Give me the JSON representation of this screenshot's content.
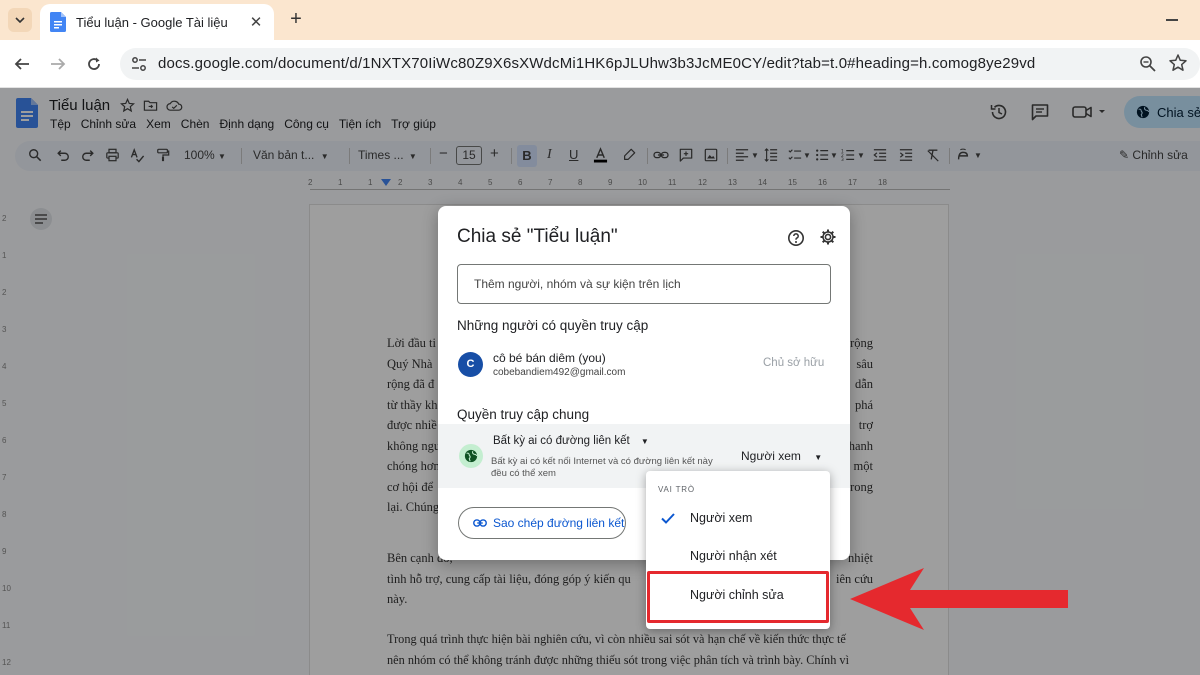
{
  "browser": {
    "tab_title": "Tiểu luận - Google Tài liệu",
    "url": "docs.google.com/document/d/1NXTX70IiWc80Z9X6sXWdcMi1HK6pJLUhw3b3JcME0CY/edit?tab=t.0#heading=h.comog8ye29vd"
  },
  "docs": {
    "title": "Tiểu luận",
    "menus": [
      "Tệp",
      "Chỉnh sửa",
      "Xem",
      "Chèn",
      "Định dạng",
      "Công cụ",
      "Tiện ích",
      "Trợ giúp"
    ],
    "share_label": "Chia sẻ"
  },
  "toolbar": {
    "zoom": "100%",
    "style": "Văn bản t...",
    "font": "Times ...",
    "font_size": "15",
    "mode": "Chỉnh sửa"
  },
  "ruler": {
    "h_ticks": [
      "2",
      "1",
      "1",
      "2",
      "3",
      "4",
      "5",
      "6",
      "7",
      "8",
      "9",
      "10",
      "11",
      "12",
      "13",
      "14",
      "15",
      "16",
      "17",
      "18"
    ],
    "v_ticks": [
      "2",
      "1",
      "2",
      "3",
      "4",
      "5",
      "6",
      "7",
      "8",
      "9",
      "10",
      "11",
      "12"
    ]
  },
  "page": {
    "lines_block1": [
      "Lời đầu ti",
      "Quý Nhà",
      "rộng đã đ",
      "từ thầy kh",
      "được nhiề",
      "không ngư",
      "chóng hơn",
      "cơ hội để",
      "lại. Chúng"
    ],
    "lines_block1_right": [
      "rộng",
      "sâu",
      "dẫn",
      "phá",
      "trợ",
      "hanh",
      "một",
      "rong",
      ""
    ],
    "block2_line1_left": "Bên cạnh đó,",
    "block2_line1_right": "nhiệt",
    "block2_line2_left": "tình hỗ trợ, cung cấp tài liệu, đóng góp ý kiến qu",
    "block2_line2_right": "iên cứu",
    "block2_line3": "này.",
    "block3_line1": "Trong quá trình thực hiện bài nghiên cứu, vì còn nhiều sai sót và hạn chế về kiến thức thực tế",
    "block3_line2": "nên nhóm có thể không tránh được những thiếu sót trong việc phân tích và trình bày. Chính vì"
  },
  "share_dialog": {
    "title": "Chia sẻ \"Tiểu luận\"",
    "add_people_placeholder": "Thêm người, nhóm và sự kiện trên lịch",
    "people_section": "Những người có quyền truy cập",
    "owner": {
      "initial": "C",
      "name": "cô bé bán diêm (you)",
      "email": "cobebandiem492@gmail.com",
      "role": "Chủ sở hữu"
    },
    "general_section": "Quyền truy cập chung",
    "link_setting": "Bất kỳ ai có đường liên kết",
    "link_desc": "Bất kỳ ai có kết nối Internet và có đường liên kết này đều có thể xem",
    "current_role": "Người xem",
    "copy_link": "Sao chép đường liên kết"
  },
  "role_menu": {
    "header": "VAI TRÒ",
    "items": [
      "Người xem",
      "Người nhận xét",
      "Người chỉnh sửa"
    ],
    "selected": "Người xem",
    "highlighted": "Người chỉnh sửa"
  },
  "colors": {
    "accent_blue": "#0b57d0",
    "share_button": "#c2e7ff",
    "highlight_red": "#e5292e"
  }
}
